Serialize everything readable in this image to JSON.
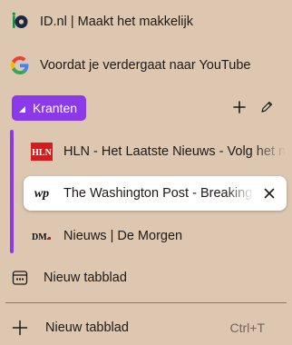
{
  "tabs": {
    "top": [
      {
        "title": "ID.nl | Maakt het makkelijk",
        "favicon": "idnl-logo-icon"
      },
      {
        "title": "Voordat je verdergaat naar YouTube",
        "favicon": "google-logo-icon"
      }
    ],
    "group": {
      "name": "Kranten",
      "color": "#8a3ae8",
      "add_icon": "plus-icon",
      "edit_icon": "pencil-icon",
      "items": [
        {
          "title": "HLN - Het Laatste Nieuws - Volg het nieuws",
          "favicon_text": "HLN",
          "active": false
        },
        {
          "title": "The Washington Post - Breaking news",
          "favicon_text": "wp",
          "active": true,
          "close_icon": "close-icon"
        },
        {
          "title": "Nieuws | De Morgen",
          "favicon_text": "DM.",
          "active": false
        }
      ]
    },
    "new_tab_page": {
      "title": "Nieuw tabblad",
      "favicon": "new-tab-page-icon"
    }
  },
  "new_tab_button": {
    "label": "Nieuw tabblad",
    "shortcut": "Ctrl+T",
    "icon": "plus-icon"
  }
}
